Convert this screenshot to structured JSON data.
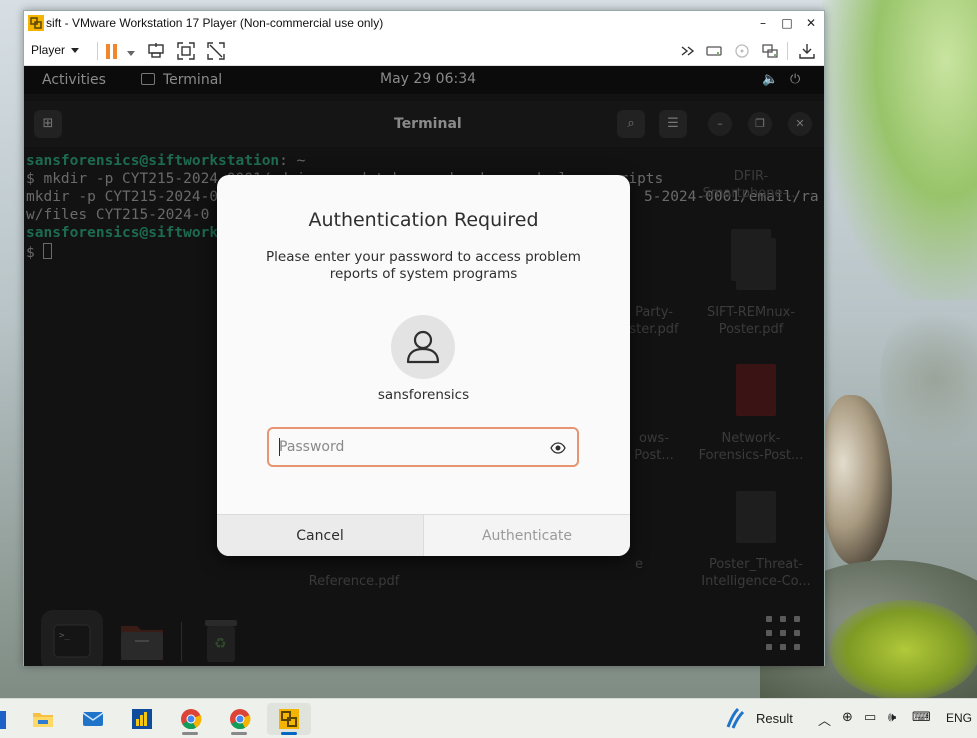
{
  "vm_window": {
    "title": "sift - VMware Workstation 17 Player (Non-commercial use only)",
    "player_menu": "Player",
    "controls": {
      "minimize": "–",
      "maximize": "□",
      "close": "✕"
    }
  },
  "guest": {
    "topbar": {
      "activities": "Activities",
      "app_name": "Terminal",
      "clock": "May 29  06:34"
    },
    "terminal": {
      "title": "Terminal",
      "lines": [
        {
          "prompt": "sansforensics@siftworkstation",
          "suffix": ": ~"
        },
        {
          "text": "$ mkdir -p CYT215-2024-0001/admin coc databases dec keywords logs scripts"
        },
        {
          "text": "mkdir -p CYT215-2024-0",
          "tail": "5-2024-0001/email/ra"
        },
        {
          "text": "w/files CYT215-2024-0"
        },
        {
          "prompt": "sansforensics@siftwork"
        },
        {
          "text": "$ "
        }
      ]
    },
    "desktop_icons": [
      {
        "label": "DFIR-\nSmartphone-..."
      },
      {
        "label": "Party-\nster.pdf"
      },
      {
        "label": "SIFT-REMnux-\nPoster.pdf"
      },
      {
        "label": "ows-\nPost..."
      },
      {
        "label": "Network-\nForensics-Post..."
      },
      {
        "label": "Reference.pdf"
      },
      {
        "label": "Poster_Threat-\nIntelligence-Co..."
      },
      {
        "label": "e"
      }
    ]
  },
  "dialog": {
    "title": "Authentication Required",
    "message": "Please enter your password to access problem reports of system programs",
    "username": "sansforensics",
    "password_placeholder": "Password",
    "password_value": "",
    "cancel_label": "Cancel",
    "authenticate_label": "Authenticate"
  },
  "taskbar": {
    "apps": [
      "File Explorer",
      "Mail",
      "Power BI",
      "Google Chrome",
      "Google Chrome",
      "VMware Workstation Player"
    ],
    "weather_label": "Result",
    "language": "ENG"
  },
  "colors": {
    "accent_orange": "#f2862c",
    "focus_ring": "#e79471",
    "terminal_prompt": "#1d6b52",
    "dialog_bg": "#fafafa"
  }
}
